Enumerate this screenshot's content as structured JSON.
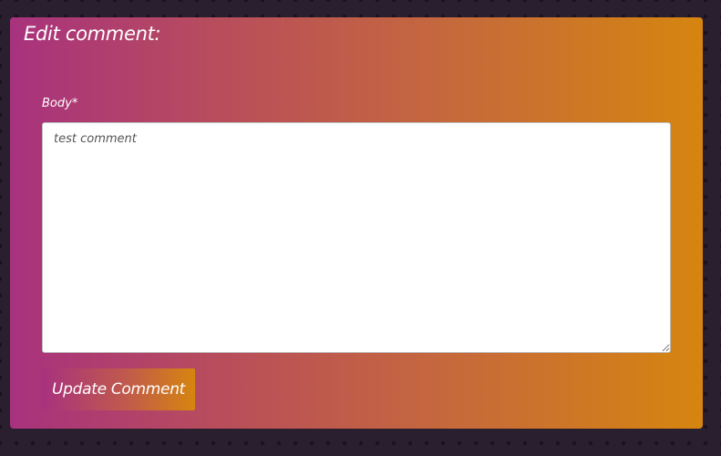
{
  "form": {
    "title": "Edit comment:",
    "body_label": "Body*",
    "body_value": "test comment",
    "submit_label": "Update Comment"
  },
  "colors": {
    "page_background": "#2a1f2e",
    "gradient_start": "#a8327e",
    "gradient_end": "#d6850f",
    "text": "#ffffff"
  }
}
